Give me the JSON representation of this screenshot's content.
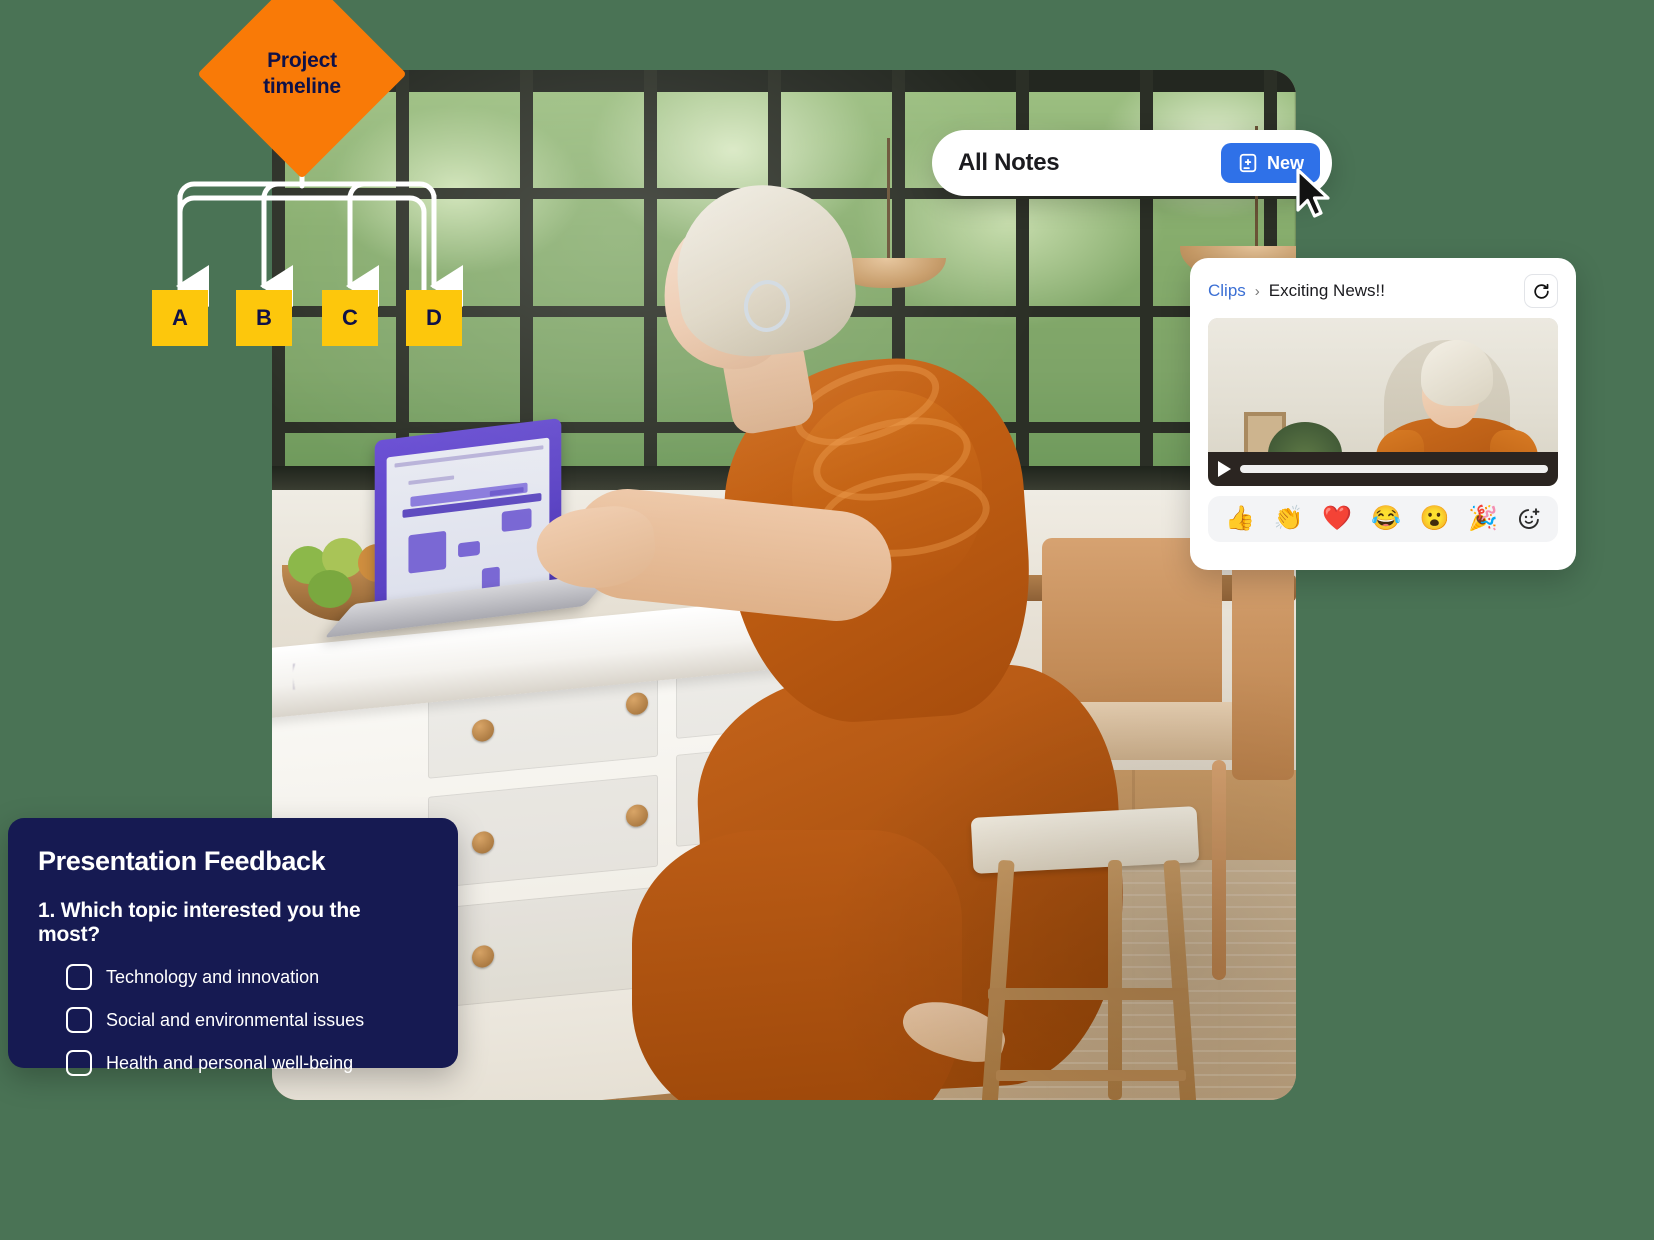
{
  "background_color": "#4a7355",
  "flowchart": {
    "root": {
      "label": "Project timeline",
      "fill": "#f97a07",
      "text_color": "#0f1147"
    },
    "nodes": [
      {
        "label": "A",
        "fill": "#fdc70c"
      },
      {
        "label": "B",
        "fill": "#fdc70c"
      },
      {
        "label": "C",
        "fill": "#fdc70c"
      },
      {
        "label": "D",
        "fill": "#fdc70c"
      }
    ],
    "connector_color": "#ffffff"
  },
  "notes_bar": {
    "title": "All Notes",
    "new_button": {
      "label": "New",
      "icon": "note-plus-icon",
      "color": "#2f71e8"
    },
    "cursor": "mouse-pointer-icon"
  },
  "clips_panel": {
    "breadcrumb": {
      "parent": "Clips",
      "separator": "›",
      "current": "Exciting News!!"
    },
    "refresh_icon": "refresh-icon",
    "video": {
      "play_icon": "play-icon",
      "progress_percent": 0
    },
    "reactions": [
      {
        "name": "thumbs-up-emoji",
        "glyph": "👍"
      },
      {
        "name": "clap-emoji",
        "glyph": "👏"
      },
      {
        "name": "heart-emoji",
        "glyph": "❤️"
      },
      {
        "name": "joy-emoji",
        "glyph": "😂"
      },
      {
        "name": "surprised-emoji",
        "glyph": "😮"
      },
      {
        "name": "party-popper-emoji",
        "glyph": "🎉"
      }
    ],
    "add_reaction_icon": "add-reaction-icon",
    "add_reaction_glyph": "☺"
  },
  "feedback_card": {
    "title": "Presentation Feedback",
    "background_color": "#161a52",
    "question_number": "1.",
    "question": "Which topic interested you the most?",
    "options": [
      "Technology and innovation",
      "Social and environmental issues",
      "Health and personal well-being"
    ]
  }
}
